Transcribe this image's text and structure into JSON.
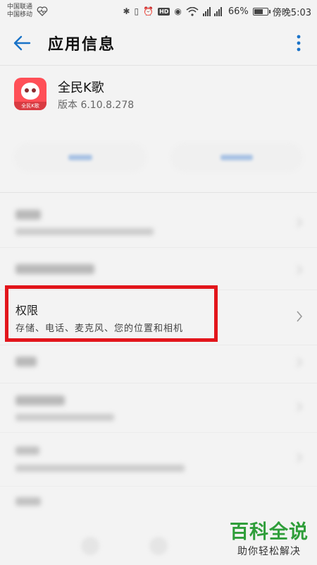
{
  "status_bar": {
    "carrier_1": "中国联通",
    "carrier_2": "中国移动",
    "battery_percent": "66%",
    "battery_level": 0.66,
    "time_label": "傍晚5:03"
  },
  "app_bar": {
    "title": "应用信息"
  },
  "app": {
    "name": "全民K歌",
    "version": "版本 6.10.8.278",
    "icon_band_text": "全民K歌"
  },
  "permissions_row": {
    "title": "权限",
    "subtitle": "存储、电话、麦克风、您的位置和相机"
  },
  "watermark": {
    "title": "百科全说",
    "subtitle": "助你轻松解决"
  },
  "colors": {
    "accent": "#1a73c8",
    "highlight": "#e2151b",
    "watermark_green": "#2f9e3a"
  }
}
